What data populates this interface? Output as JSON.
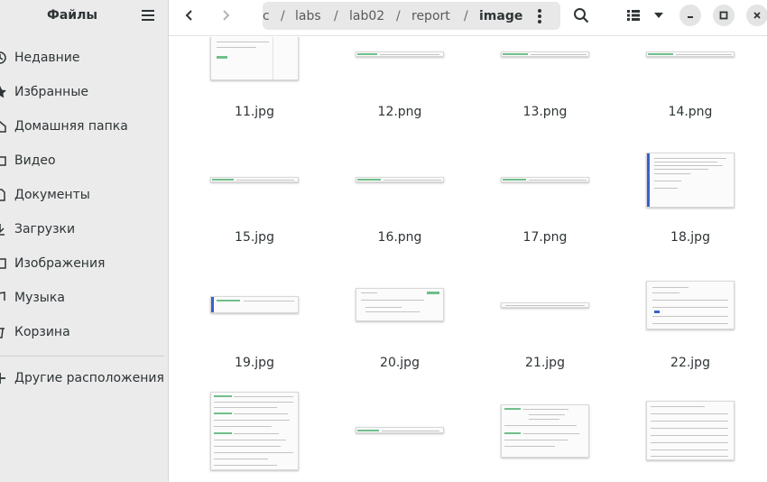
{
  "sidebar": {
    "title": "Файлы",
    "places": [
      {
        "label": "Недавние",
        "icon": "clock-icon"
      },
      {
        "label": "Избранные",
        "icon": "star-icon"
      },
      {
        "label": "Домашняя папка",
        "icon": "home-icon"
      },
      {
        "label": "Видео",
        "icon": "video-icon"
      },
      {
        "label": "Документы",
        "icon": "document-icon"
      },
      {
        "label": "Загрузки",
        "icon": "download-icon"
      },
      {
        "label": "Изображения",
        "icon": "image-icon"
      },
      {
        "label": "Музыка",
        "icon": "music-icon"
      },
      {
        "label": "Корзина",
        "icon": "trash-icon"
      }
    ],
    "other_locations": "Другие расположения"
  },
  "breadcrumb": {
    "items": [
      "c",
      "labs",
      "lab02",
      "report",
      "image"
    ],
    "separator": "/"
  },
  "files": [
    {
      "name": "11.jpg"
    },
    {
      "name": "12.png"
    },
    {
      "name": "13.png"
    },
    {
      "name": "14.png"
    },
    {
      "name": "15.jpg"
    },
    {
      "name": "16.png"
    },
    {
      "name": "17.png"
    },
    {
      "name": "18.jpg"
    },
    {
      "name": "19.jpg"
    },
    {
      "name": "20.jpg"
    },
    {
      "name": "21.jpg"
    },
    {
      "name": "22.jpg"
    },
    {
      "name": ""
    },
    {
      "name": ""
    },
    {
      "name": ""
    },
    {
      "name": ""
    }
  ],
  "colors": {
    "accent": "#3a5fcd",
    "sidebar_bg": "#ebebeb",
    "path_bg": "#e8e8e8"
  }
}
